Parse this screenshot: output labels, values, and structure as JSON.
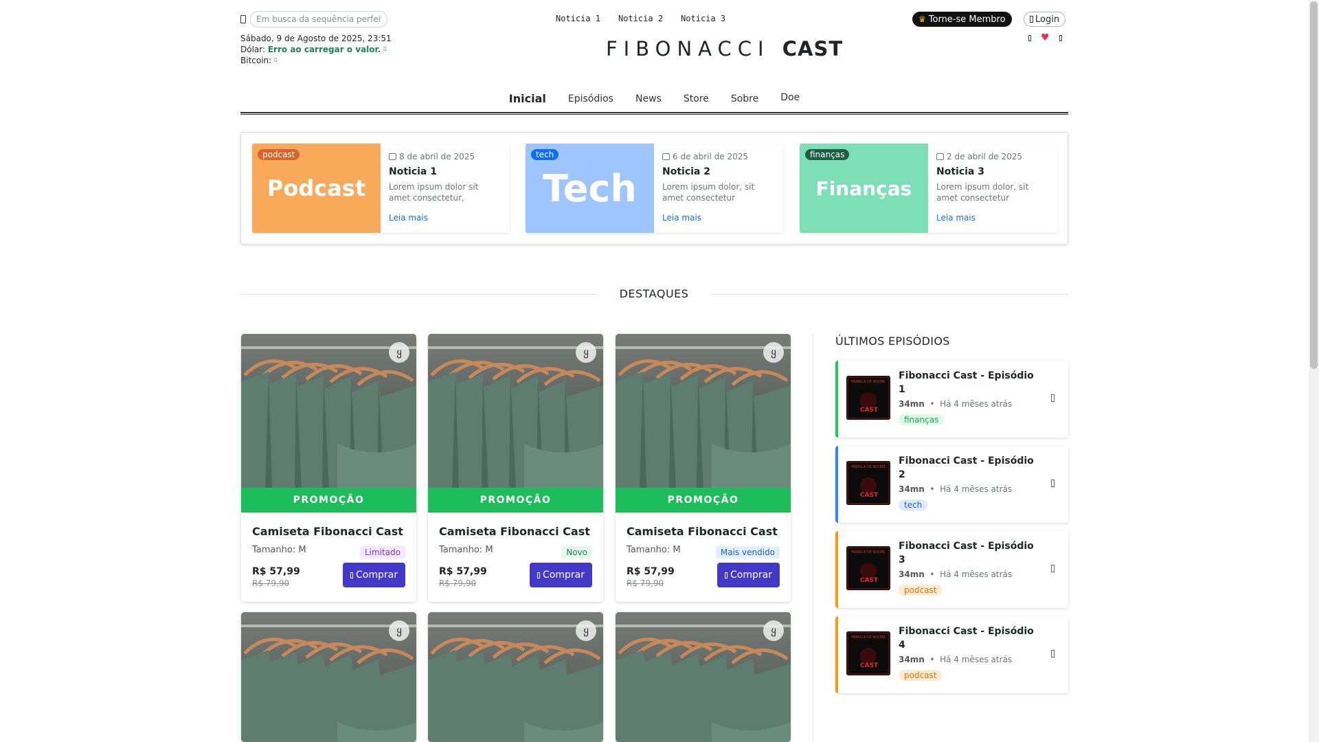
{
  "header": {
    "search_placeholder": "Em busca da sequência perfeita",
    "date": "Sábado, 9 de Agosto de 2025, 23:51",
    "dolar_label": "Dólar: ",
    "dolar_value": "Erro ao carregar o valor.",
    "bitcoin_label": "Bitcoin: ",
    "top_news": [
      "Noticia 1",
      "Noticia 2",
      "Noticia 3"
    ],
    "brand_light": "FIBONACCI",
    "brand_bold": "CAST",
    "member_label": "Torne-se Membro",
    "login_label": "Login"
  },
  "nav": {
    "items": [
      "Inicial",
      "Episódios",
      "News",
      "Store",
      "Sobre",
      "Doe"
    ],
    "active": "Inicial"
  },
  "news": [
    {
      "badge": "podcast",
      "thumb_text": "Podcast",
      "date": "8 de abril de 2025",
      "title": "Noticia 1",
      "excerpt": "Lorem ipsum dolor sit amet consectetur, adipisicing elit.",
      "link": "Leia mais",
      "color": "#f8a95a"
    },
    {
      "badge": "tech",
      "thumb_text": "Tech",
      "date": "6 de abril de 2025",
      "title": "Noticia 2",
      "excerpt": "Lorem ipsum dolor, sit amet consectetur adipisicing elit.",
      "link": "Leia mais",
      "color": "#9ec5fe"
    },
    {
      "badge": "finanças",
      "thumb_text": "Finanças",
      "date": "2 de abril de 2025",
      "title": "Noticia 3",
      "excerpt": "Lorem ipsum dolor, sit amet consectetur adipisicing elit. Autem.",
      "link": "Leia mais",
      "color": "#7ddfb6"
    }
  ],
  "destaques_title": "DESTAQUES",
  "products": [
    {
      "name": "Camiseta Fibonacci Cast",
      "promo": "PROMOÇÃO",
      "size": "Tamanho: M",
      "tag": "Limitado",
      "price": "R$ 57,99",
      "old_price": "R$ 79,90",
      "buy": "Comprar"
    },
    {
      "name": "Camiseta Fibonacci Cast",
      "promo": "PROMOÇÃO",
      "size": "Tamanho: M",
      "tag": "Novo",
      "price": "R$ 57,99",
      "old_price": "R$ 79,90",
      "buy": "Comprar"
    },
    {
      "name": "Camiseta Fibonacci Cast",
      "promo": "PROMOÇÃO",
      "size": "Tamanho: M",
      "tag": "Mais vendido",
      "price": "R$ 57,99",
      "old_price": "R$ 79,90",
      "buy": "Comprar"
    }
  ],
  "episodes_title": "ÚLTIMOS EPISÓDIOS",
  "episodes": [
    {
      "title": "Fibonacci Cast - Episódio 1",
      "duration": "34mn",
      "ago": "Há 4 mêses atrás",
      "tag": "finanças"
    },
    {
      "title": "Fibonacci Cast - Episódio 2",
      "duration": "34mn",
      "ago": "Há 4 mêses atrás",
      "tag": "tech"
    },
    {
      "title": "Fibonacci Cast - Episódio 3",
      "duration": "34mn",
      "ago": "Há 4 mêses atrás",
      "tag": "podcast"
    },
    {
      "title": "Fibonacci Cast - Episódio 4",
      "duration": "34mn",
      "ago": "Há 4 mêses atrás",
      "tag": "podcast"
    }
  ]
}
